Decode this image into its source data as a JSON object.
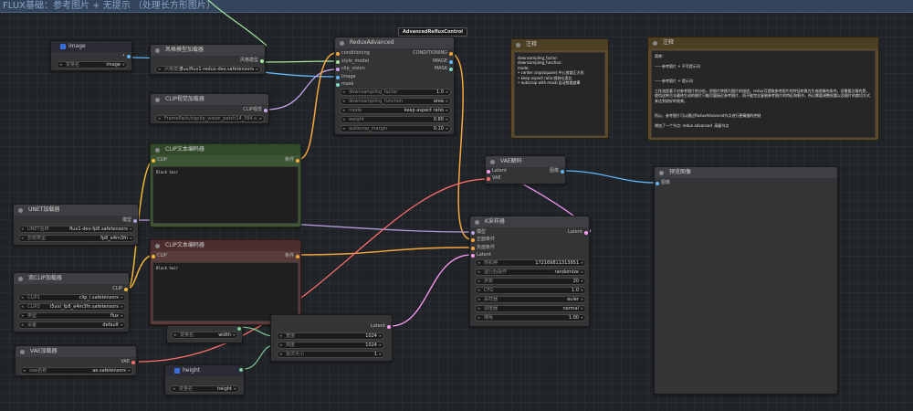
{
  "group_title": "FLUX基础：参考图片 + 无提示 （处理长方形图片）",
  "colors": {
    "clip": "#f5b93a",
    "conditioning": "#f5a73e",
    "model": "#b39ddb",
    "latent": "#ff9cf9",
    "vae": "#ff6e6e",
    "image": "#64b5f6",
    "style": "#a8e6a1",
    "int": "#7ec896",
    "mask": "#7fd8c8"
  },
  "image_node": {
    "title": "image",
    "out_dot": "•",
    "widget_label": "变量名",
    "widget_value": "image"
  },
  "style_loader": {
    "title": "风格模型加载器",
    "out_label": "风格模型",
    "widget_label": "风格模型",
    "widget_value": "flux/flux1-redux-dev.safetensors"
  },
  "clipvision_loader": {
    "title": "CLIP视觉加载器",
    "out_label": "CLIP视觉",
    "widget_value": "FramePack/sigclip_vision_patch14_384.s..."
  },
  "redux": {
    "title": "ReduxAdvanced",
    "badge": "AdvancedRefluxControl",
    "inputs": [
      "conditioning",
      "style_model",
      "clip_vision",
      "image",
      "mask"
    ],
    "outputs": [
      "CONDITIONING",
      "IMAGE",
      "MASK"
    ],
    "widgets": [
      {
        "label": "downsampling_factor",
        "value": "1.0"
      },
      {
        "label": "downsampling_function",
        "value": "area"
      },
      {
        "label": "mode",
        "value": "keep aspect ratio"
      },
      {
        "label": "weight",
        "value": "0.80"
      },
      {
        "label": "autocrop_margin",
        "value": "0.10"
      }
    ]
  },
  "clip_pos": {
    "title": "CLIP文本编码器",
    "in_label": "CLIP",
    "out_label": "条件",
    "text": "Black hair"
  },
  "clip_neg": {
    "title": "CLIP文本编码器",
    "in_label": "CLIP",
    "out_label": "条件",
    "text": "Black hair"
  },
  "unet": {
    "title": "UNET加载器",
    "out_label": "模型",
    "widgets": [
      {
        "label": "UNET名称",
        "value": "flux1-dev-fp8.safetensors"
      },
      {
        "label": "剪枝类型",
        "value": "fp8_e4m3fn"
      }
    ]
  },
  "dualclip": {
    "title": "双CLIP加载器",
    "out_label": "CLIP",
    "widgets": [
      {
        "label": "CLIP1",
        "value": "clip_l.safetensors"
      },
      {
        "label": "CLIP2",
        "value": "t5xxl_fp8_e4m3fn.safetensors"
      },
      {
        "label": "类型",
        "value": "flux"
      },
      {
        "label": "设备",
        "value": "default"
      }
    ]
  },
  "vae_loader": {
    "title": "VAE加载器",
    "out_label": "VAE",
    "widget_label": "vae名称",
    "widget_value": "ae.safetensors"
  },
  "width_node": {
    "widget_label": "变量名",
    "widget_value": "width"
  },
  "height_node": {
    "title": "height",
    "widget_label": "变量名",
    "widget_value": "height"
  },
  "empty_latent": {
    "out_label": "Latent",
    "widgets": [
      {
        "label": "宽度",
        "value": "1024"
      },
      {
        "label": "高度",
        "value": "1024"
      },
      {
        "label": "批次大小",
        "value": "1"
      }
    ]
  },
  "ksampler": {
    "title": "K采样器",
    "inputs": [
      "模型",
      "正面条件",
      "负面条件",
      "Latent"
    ],
    "out_label": "Latent",
    "widgets": [
      {
        "label": "随机种",
        "value": "172169811313951"
      },
      {
        "label": "运行后操作",
        "value": "randomize"
      },
      {
        "label": "步数",
        "value": "20"
      },
      {
        "label": "CFG",
        "value": "1.0"
      },
      {
        "label": "采样器",
        "value": "euler"
      },
      {
        "label": "调度器",
        "value": "normal"
      },
      {
        "label": "降噪",
        "value": "1.00"
      }
    ]
  },
  "vae_decode": {
    "title": "VAE解码",
    "inputs": [
      "Latent",
      "VAE"
    ],
    "out_label": "图像"
  },
  "preview": {
    "title": "预览图像",
    "in_label": "图像"
  },
  "note1": {
    "title": "注释",
    "text": "downsampling_factor:\ndownsampling_function:\nmode:\n• center crop(square):中心剪裁正方形\n• keep aspect ratio:保持长宽比\n• autocrop with mask:自动剪裁遮罩"
  },
  "note2": {
    "title": "注释",
    "text": "简称：\n\n——参考图片 + 不写提示词\n\n\n——参考图片 + 提示词\n\n工作流是基于对参考图片的分析，把图片转换为图片的描述。redux可提取参考图片的特征转换为生成图像的条件。但需要注意的是，使用这种方法最终生成的图片只能尽量接近参考图片，而不能完全复制参考图片的特征和细节，所以需要调整权重以及图片的裁切方式来达到较好的效果。\n\n\n所以，参考图片可以通过ReduxAdvanced节点进行更精细的控制\n\n增加了一个节点: redux advanced  高级节点"
  }
}
